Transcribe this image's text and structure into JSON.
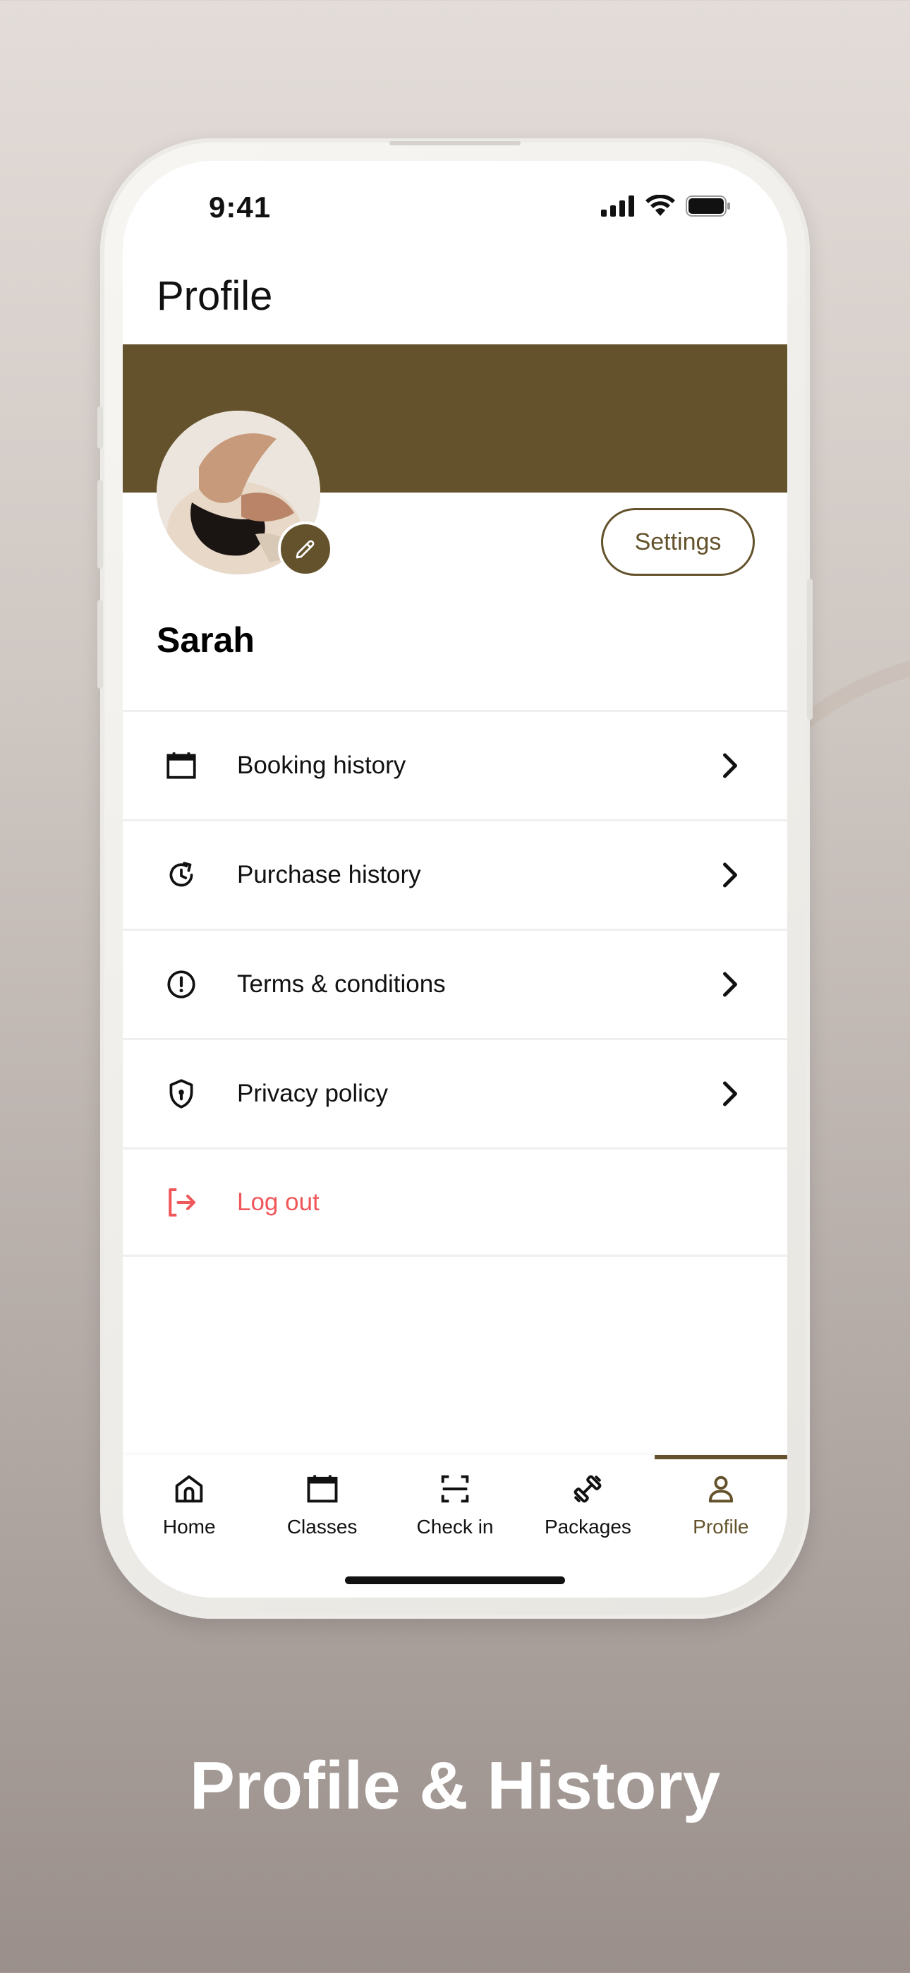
{
  "status_bar": {
    "time": "9:41",
    "icons": [
      "cellular-signal-icon",
      "wifi-icon",
      "battery-icon"
    ]
  },
  "header": {
    "title": "Profile"
  },
  "profile": {
    "name": "Sarah",
    "settings_label": "Settings",
    "avatar_icon": "avatar-photo",
    "edit_icon": "pencil-icon"
  },
  "menu": {
    "items": [
      {
        "label": "Booking history",
        "icon": "calendar-icon"
      },
      {
        "label": "Purchase history",
        "icon": "history-icon"
      },
      {
        "label": "Terms & conditions",
        "icon": "info-alert-icon"
      },
      {
        "label": "Privacy policy",
        "icon": "shield-lock-icon"
      },
      {
        "label": "Log out",
        "icon": "logout-icon"
      }
    ]
  },
  "tabbar": {
    "items": [
      {
        "label": "Home",
        "icon": "home-icon"
      },
      {
        "label": "Classes",
        "icon": "calendar-icon"
      },
      {
        "label": "Check in",
        "icon": "scan-icon"
      },
      {
        "label": "Packages",
        "icon": "dumbbell-icon"
      },
      {
        "label": "Profile",
        "icon": "person-icon"
      }
    ],
    "active": "Profile"
  },
  "caption": "Profile & History",
  "colors": {
    "brand": "#63522b",
    "logout": "#f0575a",
    "text": "#111111"
  }
}
